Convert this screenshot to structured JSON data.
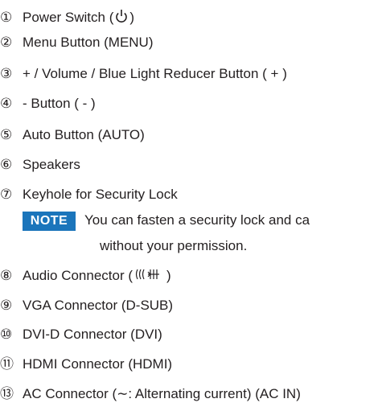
{
  "items": [
    {
      "num": "①",
      "before": "Power Switch (",
      "icon": "power-icon",
      "after": ")"
    },
    {
      "num": "②",
      "text": "Menu Button (MENU)"
    },
    {
      "num": "③",
      "text": "+ / Volume / Blue Light Reducer Button ( + )"
    },
    {
      "num": "④",
      "text": "- Button ( - )"
    },
    {
      "num": "⑤",
      "text": "Auto Button (AUTO)"
    },
    {
      "num": "⑥",
      "text": "Speakers"
    },
    {
      "num": "⑦",
      "text": "Keyhole for Security Lock"
    },
    {
      "num": "⑧",
      "before": "Audio Connector (",
      "icon": "audio-icon",
      "after": ")"
    },
    {
      "num": "⑨",
      "text": "VGA Connector (D-SUB)"
    },
    {
      "num": "⑩",
      "text": "DVI-D Connector (DVI)"
    },
    {
      "num": "⑪",
      "text": "HDMI Connector (HDMI)"
    },
    {
      "num": "⑬",
      "text": "AC Connector (∼: Alternating current) (AC IN)"
    }
  ],
  "note": {
    "label": "NOTE",
    "line1": "You can fasten a security lock and ca",
    "line2": "without your permission."
  }
}
